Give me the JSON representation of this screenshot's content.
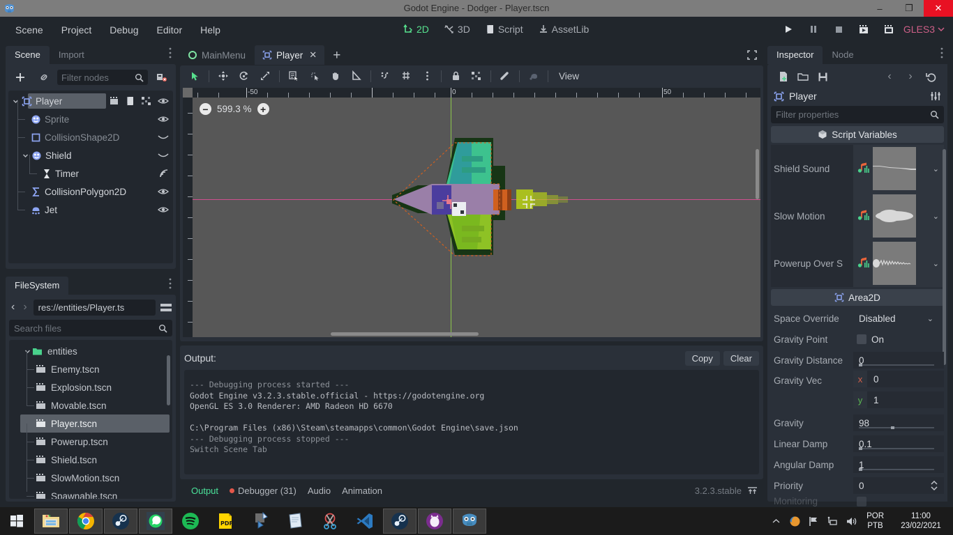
{
  "window": {
    "title": "Godot Engine - Dodger - Player.tscn",
    "minimize": "–",
    "maximize": "❐",
    "close": "✕"
  },
  "menu": {
    "items": [
      "Scene",
      "Project",
      "Debug",
      "Editor",
      "Help"
    ]
  },
  "main_modes": [
    {
      "label": "2D",
      "icon": "axes-2d-icon",
      "active": true
    },
    {
      "label": "3D",
      "icon": "axes-3d-icon",
      "active": false
    },
    {
      "label": "Script",
      "icon": "script-icon",
      "active": false
    },
    {
      "label": "AssetLib",
      "icon": "download-icon",
      "active": false
    }
  ],
  "playback": {
    "play": "play-icon",
    "pause": "pause-icon",
    "stop": "stop-icon",
    "play_scene": "play-scene-icon",
    "play_custom": "play-custom-scene-icon",
    "renderer": "GLES3"
  },
  "scene_dock": {
    "tabs": [
      {
        "label": "Scene",
        "active": true
      },
      {
        "label": "Import",
        "active": false
      }
    ],
    "toolbar": {
      "add_label": "+",
      "link_label": "link-icon",
      "filter_placeholder": "Filter nodes",
      "search_icon": "search-icon",
      "remote_icon": "scene-tree-icon"
    },
    "nodes": [
      {
        "name": "Player",
        "depth": 0,
        "icon": "area2d-icon",
        "selected": true,
        "dim": false,
        "expand": "⌄",
        "right_icons": [
          "group-icon",
          "script-icon",
          "connect-icon",
          "eye-icon"
        ]
      },
      {
        "name": "Sprite",
        "depth": 1,
        "icon": "sprite-icon",
        "selected": false,
        "dim": true,
        "expand": "",
        "right_icons": [
          "eye-icon"
        ]
      },
      {
        "name": "CollisionShape2D",
        "depth": 1,
        "icon": "collisionshape2d-icon",
        "selected": false,
        "dim": true,
        "expand": "",
        "right_icons": [
          "visibility-off-icon"
        ]
      },
      {
        "name": "Shield",
        "depth": 1,
        "icon": "sprite-icon",
        "selected": false,
        "dim": false,
        "expand": "⌄",
        "right_icons": [
          "visibility-off-icon"
        ]
      },
      {
        "name": "Timer",
        "depth": 2,
        "icon": "timer-icon",
        "selected": false,
        "dim": false,
        "expand": "",
        "right_icons": [
          "signal-icon"
        ]
      },
      {
        "name": "CollisionPolygon2D",
        "depth": 1,
        "icon": "collisionpolygon2d-icon",
        "selected": false,
        "dim": false,
        "expand": "",
        "right_icons": [
          "eye-icon"
        ]
      },
      {
        "name": "Jet",
        "depth": 1,
        "icon": "particles2d-icon",
        "selected": false,
        "dim": false,
        "expand": "",
        "right_icons": [
          "eye-icon"
        ]
      }
    ]
  },
  "filesystem_dock": {
    "tab_label": "FileSystem",
    "nav_back": "‹",
    "nav_forward": "›",
    "path": "res://entities/Player.ts",
    "split_icon": "split-mode-icon",
    "search_placeholder": "Search files",
    "search_icon": "search-icon",
    "items": [
      {
        "name": "entities",
        "type": "folder",
        "depth": 0,
        "selected": false
      },
      {
        "name": "Enemy.tscn",
        "type": "scene",
        "depth": 1,
        "selected": false
      },
      {
        "name": "Explosion.tscn",
        "type": "scene",
        "depth": 1,
        "selected": false
      },
      {
        "name": "Movable.tscn",
        "type": "scene",
        "depth": 1,
        "selected": false
      },
      {
        "name": "Player.tscn",
        "type": "scene",
        "depth": 1,
        "selected": true
      },
      {
        "name": "Powerup.tscn",
        "type": "scene",
        "depth": 1,
        "selected": false
      },
      {
        "name": "Shield.tscn",
        "type": "scene",
        "depth": 1,
        "selected": false
      },
      {
        "name": "SlowMotion.tscn",
        "type": "scene",
        "depth": 1,
        "selected": false
      },
      {
        "name": "Spawnable.tscn",
        "type": "scene",
        "depth": 1,
        "selected": false
      }
    ]
  },
  "editor": {
    "scene_tabs": [
      {
        "label": "MainMenu",
        "icon": "node2d-icon",
        "active": false,
        "closable": false
      },
      {
        "label": "Player",
        "icon": "area2d-icon",
        "active": true,
        "closable": true,
        "close": "✕"
      }
    ],
    "add_tab": "+",
    "fullscreen_icon": "distraction-free-icon",
    "viewport_toolbar": {
      "tools": [
        "select-mode-icon",
        "move-mode-icon",
        "rotate-mode-icon",
        "scale-mode-icon",
        "list-select-icon",
        "pivot-mode-icon",
        "pan-mode-icon",
        "ruler-mode-icon",
        "snap-mode-icon",
        "snap-config-icon",
        "more-options-icon",
        "lock-icon",
        "group-icon",
        "skeleton-icon",
        "bone-icon"
      ],
      "view_label": "View"
    },
    "zoom": {
      "minus": "−",
      "value": "599.3 %",
      "plus": "+"
    },
    "ruler_labels": [
      "-50",
      "0",
      "50"
    ]
  },
  "output": {
    "title": "Output:",
    "copy_label": "Copy",
    "clear_label": "Clear",
    "lines": [
      {
        "text": "--- Debugging process started ---",
        "dim": true
      },
      {
        "text": "Godot Engine v3.2.3.stable.official - https://godotengine.org",
        "dim": false
      },
      {
        "text": "OpenGL ES 3.0 Renderer: AMD Radeon HD 6670",
        "dim": false
      },
      {
        "text": "",
        "dim": false
      },
      {
        "text": "C:\\Program Files (x86)\\Steam\\steamapps\\common\\Godot Engine\\save.json",
        "dim": false
      },
      {
        "text": "--- Debugging process stopped ---",
        "dim": true
      },
      {
        "text": "Switch Scene Tab",
        "dim": true
      }
    ]
  },
  "bottom_panel": {
    "tabs": [
      {
        "label": "Output",
        "active": true,
        "dot": false
      },
      {
        "label": "Debugger (31)",
        "active": false,
        "dot": true
      },
      {
        "label": "Audio",
        "active": false,
        "dot": false
      },
      {
        "label": "Animation",
        "active": false,
        "dot": false
      }
    ],
    "version": "3.2.3.stable",
    "expand_icon": "expand-bottom-icon"
  },
  "inspector": {
    "tabs": [
      {
        "label": "Inspector",
        "active": true
      },
      {
        "label": "Node",
        "active": false
      }
    ],
    "toolbar": {
      "new_resource": "new-resource-icon",
      "load": "folder-open-icon",
      "save": "save-icon",
      "back": "‹",
      "forward": "›",
      "history": "history-icon"
    },
    "node_name": "Player",
    "node_icon": "area2d-icon",
    "tools_icon": "object-tools-icon",
    "filter_placeholder": "Filter properties",
    "search_icon": "search-icon",
    "sections": [
      {
        "header": "Script Variables",
        "header_icon": "script-variables-icon",
        "properties": [
          {
            "name": "Shield Sound",
            "kind": "audio",
            "wave": "decay",
            "chevron": "⌄"
          },
          {
            "name": "Slow Motion",
            "kind": "audio",
            "wave": "blob",
            "chevron": "⌄"
          },
          {
            "name": "Powerup Over S",
            "kind": "audio",
            "wave": "noise",
            "chevron": "⌄"
          }
        ]
      },
      {
        "header": "Area2D",
        "header_icon": "area2d-icon",
        "properties": [
          {
            "name": "Space Override",
            "kind": "enum",
            "value": "Disabled",
            "chevron": "⌄"
          },
          {
            "name": "Gravity Point",
            "kind": "bool",
            "value": "On"
          },
          {
            "name": "Gravity Distance",
            "kind": "number",
            "value": "0",
            "knob": 2
          },
          {
            "name": "Gravity Vec",
            "kind": "vector",
            "x_label": "x",
            "x_value": "0",
            "y_label": "y",
            "y_value": "1"
          },
          {
            "name": "Gravity",
            "kind": "number",
            "value": "98",
            "knob": 58
          },
          {
            "name": "Linear Damp",
            "kind": "number",
            "value": "0.1",
            "knob": 2
          },
          {
            "name": "Angular Damp",
            "kind": "number",
            "value": "1",
            "knob": 2
          },
          {
            "name": "Priority",
            "kind": "spin",
            "value": "0",
            "spin": "⇅"
          }
        ]
      }
    ]
  },
  "taskbar": {
    "start": "windows-logo-icon",
    "apps": [
      {
        "name": "file-explorer-icon",
        "open": true
      },
      {
        "name": "google-chrome-icon",
        "open": true
      },
      {
        "name": "steam-icon",
        "open": true
      },
      {
        "name": "whatsapp-icon",
        "open": true
      },
      {
        "name": "spotify-icon",
        "open": false
      },
      {
        "name": "pdf-reader-icon",
        "open": false
      },
      {
        "name": "sticky-notes-icon",
        "open": false
      },
      {
        "name": "notepad-icon",
        "open": false
      },
      {
        "name": "snipping-tool-icon",
        "open": false
      },
      {
        "name": "vscode-icon",
        "open": false
      },
      {
        "name": "steam-window-icon",
        "open": true
      },
      {
        "name": "purple-app-icon",
        "open": true
      },
      {
        "name": "godot-engine-icon",
        "open": true
      }
    ],
    "tray": [
      "show-hidden-icon",
      "firefox-tray-icon",
      "network-flag-icon",
      "network-icon",
      "volume-icon"
    ],
    "language": {
      "line1": "POR",
      "line2": "PTB"
    },
    "clock": {
      "time": "11:00",
      "date": "23/02/2021"
    }
  },
  "colors": {
    "accent_green": "#57e18e",
    "panel_bg": "#2a3039",
    "app_bg": "#21262c",
    "field_bg": "#1c2026",
    "gles_pink": "#cd5f87",
    "axis_x": "#cf4f8f",
    "axis_y": "#8cc84b",
    "canvas_bg": "#575757",
    "selection": "#5a6068"
  }
}
